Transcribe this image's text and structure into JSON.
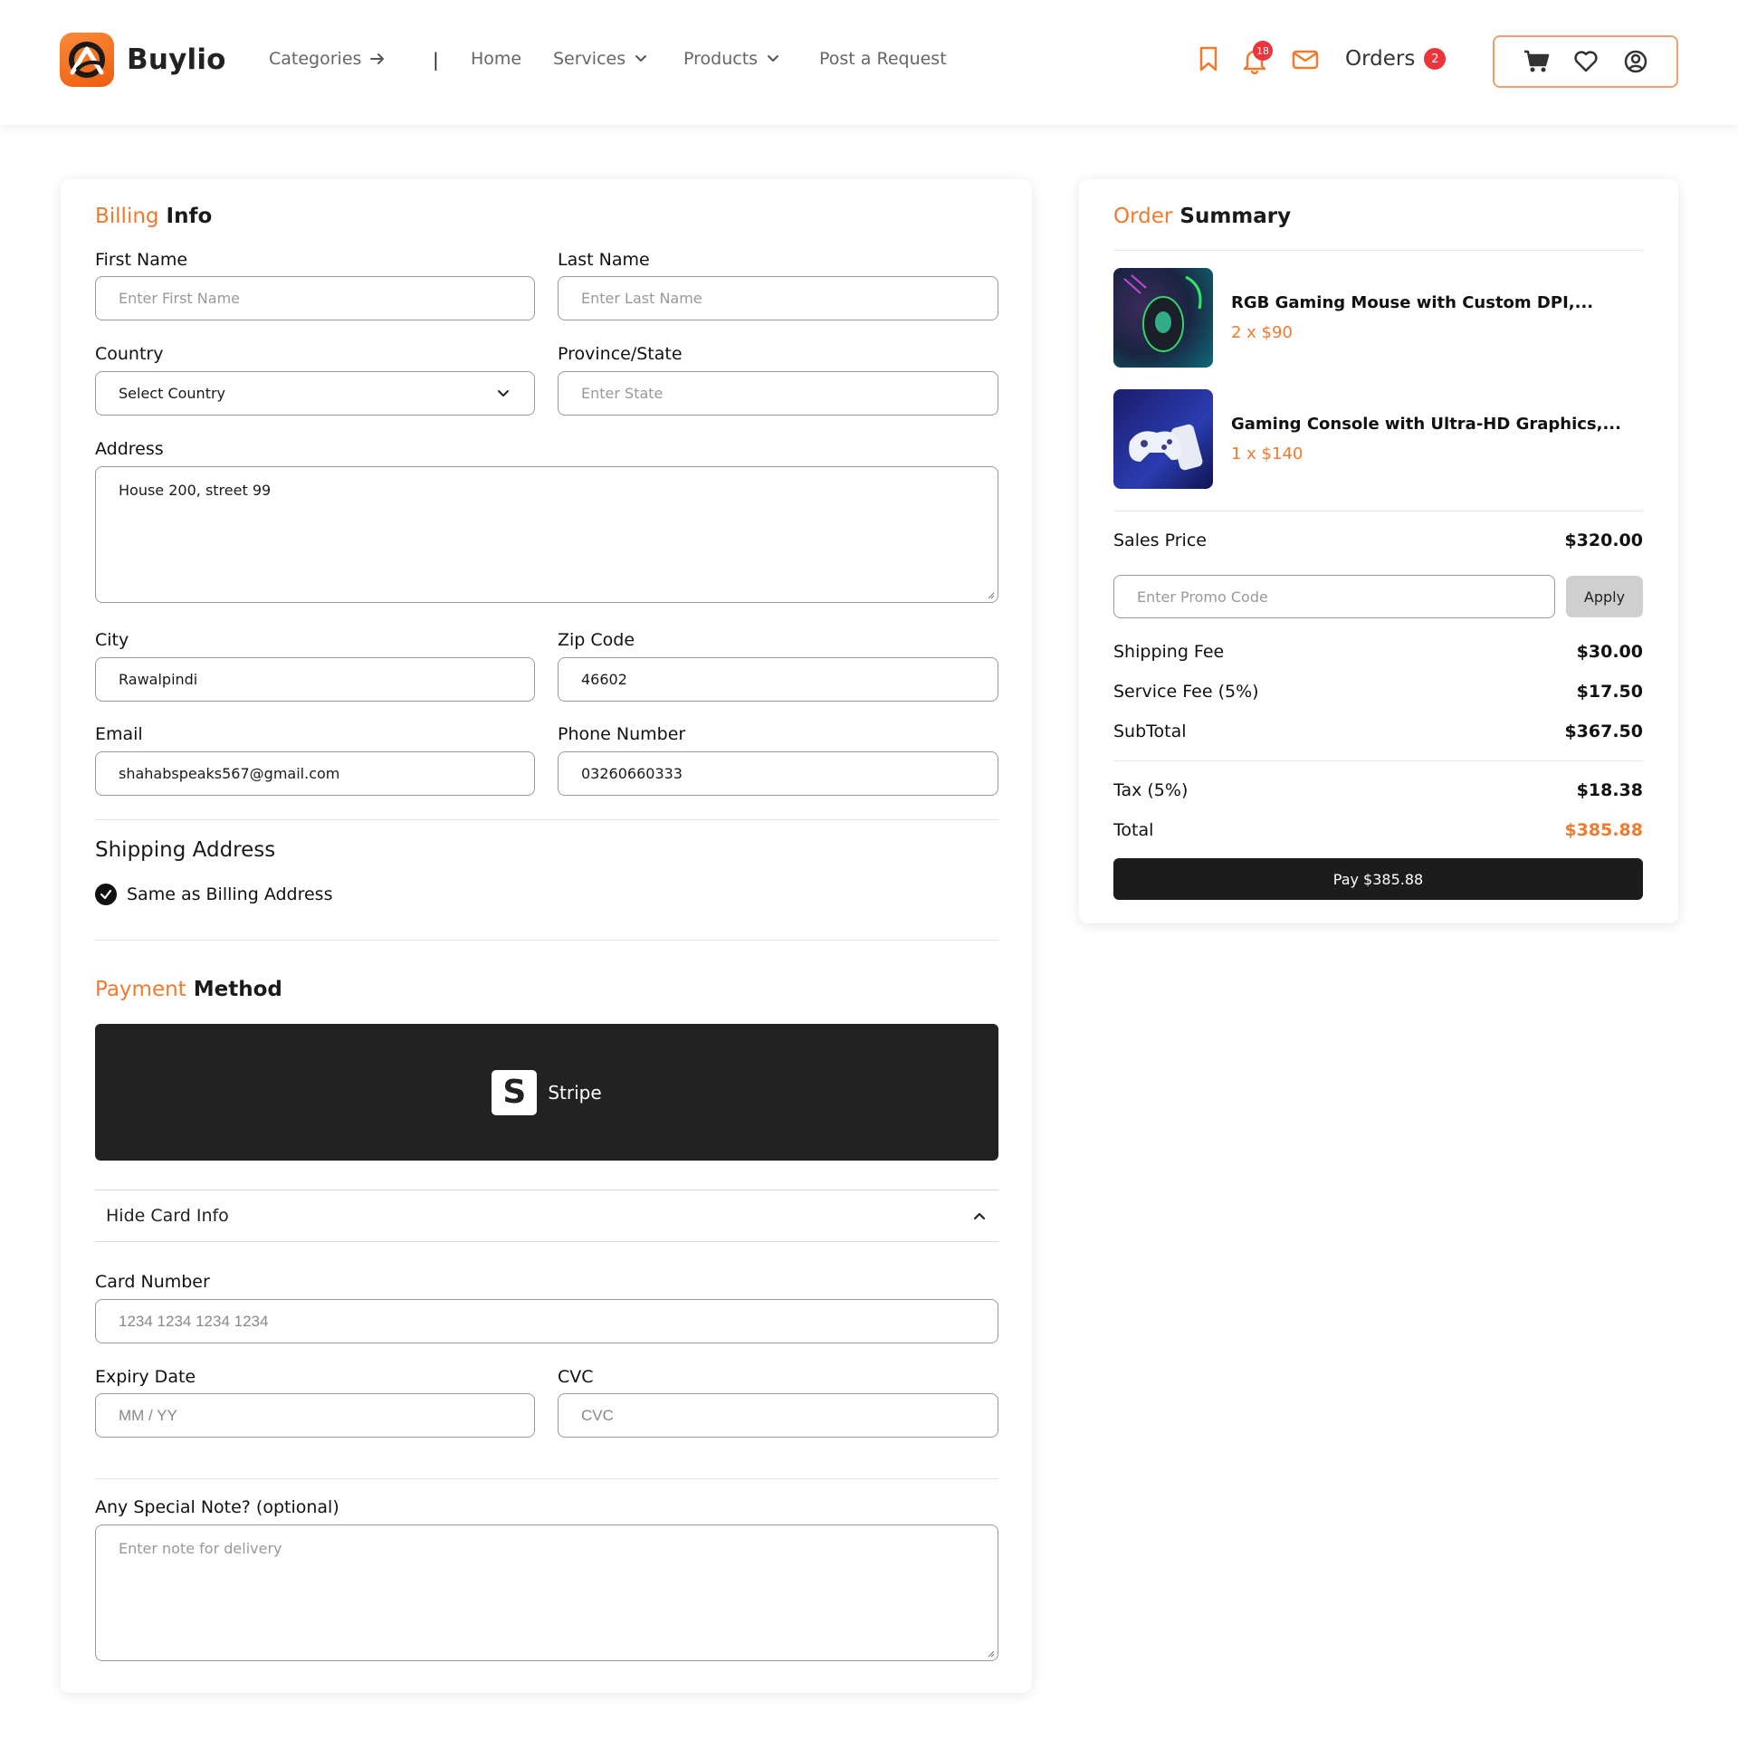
{
  "header": {
    "brand": "Buylio",
    "nav": {
      "categories": "Categories",
      "separator": "|",
      "home": "Home",
      "services": "Services",
      "products": "Products",
      "post_request": "Post a Request"
    },
    "notifications_count": "18",
    "orders_label": "Orders",
    "orders_count": "2",
    "accent_color": "#f07a2e"
  },
  "billing": {
    "title_accent": "Billing",
    "title_rest": " Info",
    "first_name": {
      "label": "First Name",
      "placeholder": "Enter First Name",
      "value": ""
    },
    "last_name": {
      "label": "Last Name",
      "placeholder": "Enter Last Name",
      "value": ""
    },
    "country": {
      "label": "Country",
      "selected": "Select Country"
    },
    "state": {
      "label": "Province/State",
      "placeholder": "Enter State",
      "value": ""
    },
    "address": {
      "label": "Address",
      "value": "House 200, street 99"
    },
    "city": {
      "label": "City",
      "value": "Rawalpindi"
    },
    "zip": {
      "label": "Zip Code",
      "value": "46602"
    },
    "email": {
      "label": "Email",
      "value": "shahabspeaks567@gmail.com"
    },
    "phone": {
      "label": "Phone Number",
      "value": "03260660333"
    }
  },
  "shipping": {
    "title": "Shipping Address",
    "same_as_billing_label": "Same as Billing Address",
    "same_as_billing_checked": true
  },
  "payment": {
    "title_accent": "Payment",
    "title_rest": " Method",
    "provider": "Stripe",
    "provider_logo_letter": "S",
    "toggle_label": "Hide Card Info",
    "card_number": {
      "label": "Card Number",
      "placeholder": "1234 1234 1234 1234"
    },
    "expiry": {
      "label": "Expiry Date",
      "placeholder": "MM / YY"
    },
    "cvc": {
      "label": "CVC",
      "placeholder": "CVC"
    },
    "note": {
      "label": "Any Special Note? (optional)",
      "placeholder": "Enter note for delivery"
    }
  },
  "summary": {
    "title_accent": "Order",
    "title_rest": " Summary",
    "items": [
      {
        "name": "RGB Gaming Mouse with Custom DPI,...",
        "qty_price": "2 x $90"
      },
      {
        "name": "Gaming Console with Ultra-HD Graphics,...",
        "qty_price": "1 x $140"
      }
    ],
    "sales_price": {
      "label": "Sales Price",
      "value": "$320.00"
    },
    "promo_placeholder": "Enter Promo Code",
    "apply_label": "Apply",
    "shipping_fee": {
      "label": "Shipping Fee",
      "value": "$30.00"
    },
    "service_fee": {
      "label": "Service Fee (5%)",
      "value": "$17.50"
    },
    "subtotal": {
      "label": "SubTotal",
      "value": "$367.50"
    },
    "tax": {
      "label": "Tax (5%)",
      "value": "$18.38"
    },
    "total": {
      "label": "Total",
      "value": "$385.88"
    },
    "pay_label": "Pay $385.88"
  }
}
